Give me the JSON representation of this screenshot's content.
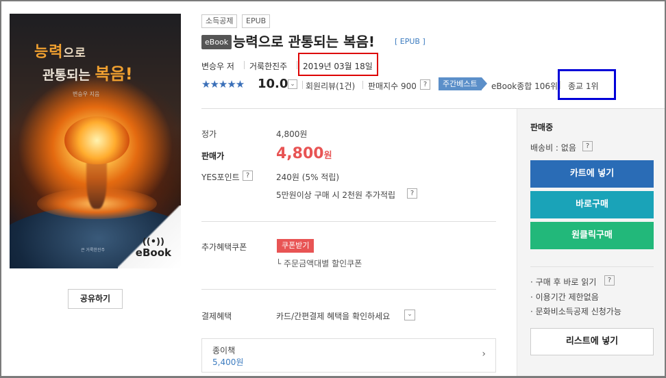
{
  "cover": {
    "title_line1_a": "능력",
    "title_line1_b": "으로",
    "title_line2_a": "관통되는 ",
    "title_line2_b": "복음!",
    "author": "변승우 지음",
    "publisher": "큰 거룩한진주",
    "ebook_label": "eBook",
    "wifi_icon": "wifi-icon"
  },
  "share_label": "공유하기",
  "tags": [
    "소득공제",
    "EPUB"
  ],
  "product": {
    "badge": "eBook",
    "title": "능력으로 관통되는 복음!",
    "format": "[ EPUB ]",
    "author": "변승우 저",
    "publisher": "거룩한진주",
    "date": "2019년 03월 18일"
  },
  "rating": {
    "stars": "★★★★★",
    "score": "10.0",
    "reviews": "회원리뷰(1건)",
    "sales_index": "판매지수 900",
    "weekly_label": "주간베스트",
    "rank_total": "eBook종합 106위",
    "rank_category": "종교 1위"
  },
  "price": {
    "list_label": "정가",
    "list_value": "4,800원",
    "sale_label": "판매가",
    "sale_value": "4,800",
    "sale_unit": "원",
    "points_label": "YES포인트",
    "points_value": "240원 (5% 적립)",
    "points_extra": "5만원이상 구매 시 2천원 추가적립"
  },
  "benefit": {
    "label": "추가혜택쿠폰",
    "coupon_label": "쿠폰받기",
    "coupon_note": "└ 주문금액대별 할인쿠폰"
  },
  "payment": {
    "label": "결제혜택",
    "text": "카드/간편결제 혜택을 확인하세요"
  },
  "paper_book": {
    "label": "종이책",
    "price": "5,400원"
  },
  "panel": {
    "status": "판매중",
    "shipping": "배송비 : 없음",
    "cart": "카트에 넣기",
    "buy": "바로구매",
    "one_click": "원클릭구매",
    "notes": [
      "· 구매 후 바로 읽기",
      "· 이용기간 제한없음",
      "· 문화비소득공제 신청가능"
    ],
    "list": "리스트에 넣기"
  },
  "colors": {
    "cart": "#2a6cb6",
    "buy": "#1aa3b8",
    "one_click": "#22b87a",
    "price": "#e85454"
  }
}
